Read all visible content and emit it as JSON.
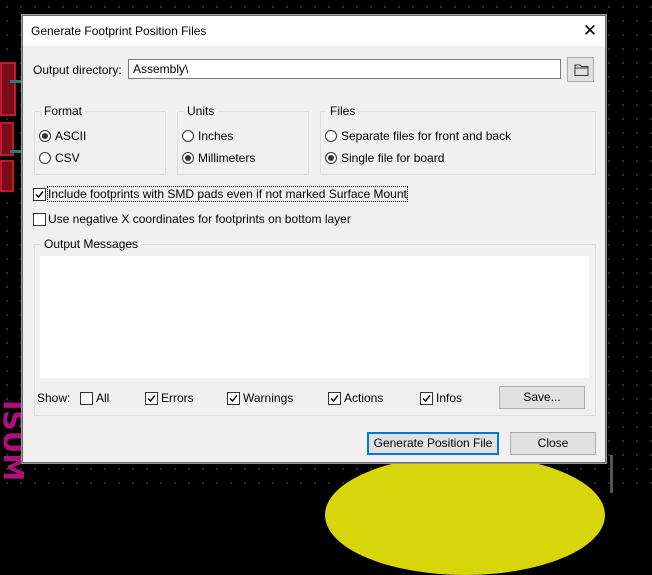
{
  "dialog": {
    "title": "Generate Footprint Position Files"
  },
  "output": {
    "label": "Output directory:",
    "value": "Assembly\\"
  },
  "format": {
    "title": "Format",
    "options": [
      {
        "label": "ASCII",
        "selected": true
      },
      {
        "label": "CSV",
        "selected": false
      }
    ]
  },
  "units": {
    "title": "Units",
    "options": [
      {
        "label": "Inches",
        "selected": false
      },
      {
        "label": "Millimeters",
        "selected": true
      }
    ]
  },
  "files": {
    "title": "Files",
    "options": [
      {
        "label": "Separate files for front and back",
        "selected": false
      },
      {
        "label": "Single file for board",
        "selected": true
      }
    ]
  },
  "options": {
    "include_smd": {
      "label": "Include footprints with SMD pads even if not marked Surface Mount",
      "checked": true
    },
    "negative_x": {
      "label": "Use negative X coordinates for footprints on bottom layer",
      "checked": false
    }
  },
  "messages": {
    "title": "Output Messages",
    "show_label": "Show:",
    "filters": [
      {
        "label": "All",
        "checked": false
      },
      {
        "label": "Errors",
        "checked": true
      },
      {
        "label": "Warnings",
        "checked": true
      },
      {
        "label": "Actions",
        "checked": true
      },
      {
        "label": "Infos",
        "checked": true
      }
    ],
    "save_label": "Save..."
  },
  "buttons": {
    "generate": "Generate Position File",
    "close": "Close"
  },
  "icons": {
    "close": "close-icon",
    "folder": "folder-icon"
  },
  "background_silk_text": "ISUM"
}
